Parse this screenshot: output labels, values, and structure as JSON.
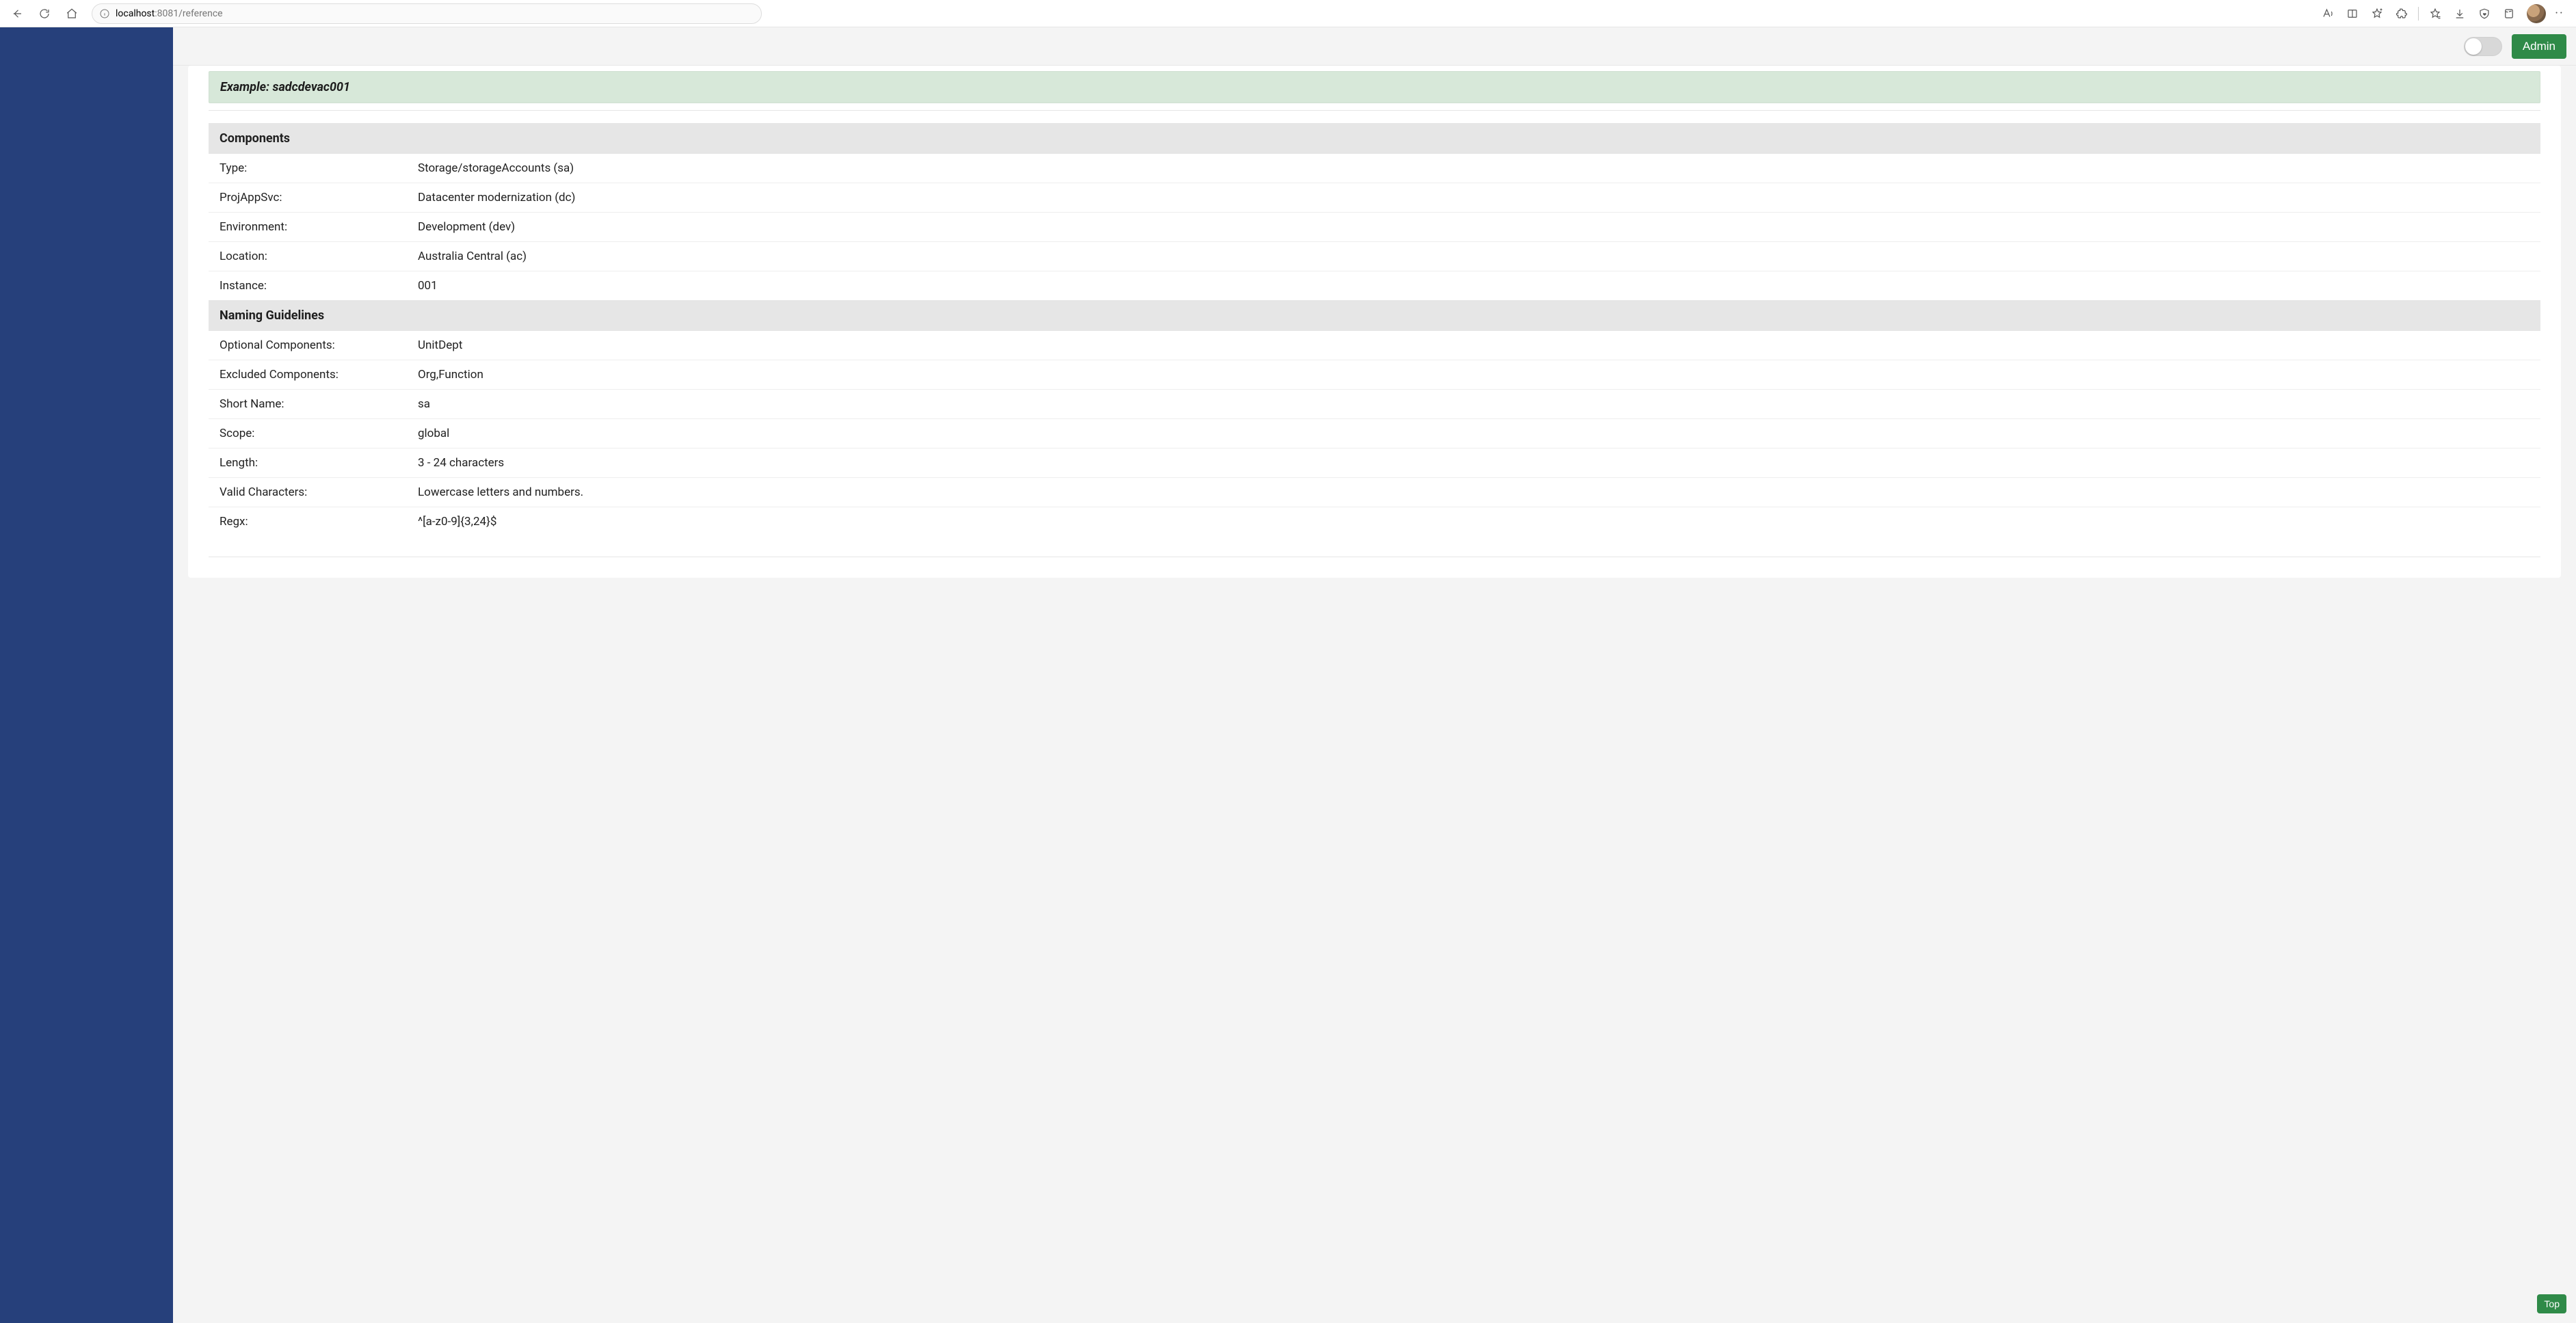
{
  "browser": {
    "url_host": "localhost",
    "url_port": ":8081",
    "url_path": "/reference"
  },
  "header": {
    "admin_label": "Admin"
  },
  "example": {
    "prefix": "Example: ",
    "value": "sadcdevac001"
  },
  "sections": {
    "components": {
      "title": "Components",
      "rows": [
        {
          "key": "Type:",
          "val": "Storage/storageAccounts (sa)"
        },
        {
          "key": "ProjAppSvc:",
          "val": "Datacenter modernization (dc)"
        },
        {
          "key": "Environment:",
          "val": "Development (dev)"
        },
        {
          "key": "Location:",
          "val": "Australia Central (ac)"
        },
        {
          "key": "Instance:",
          "val": "001"
        }
      ]
    },
    "guidelines": {
      "title": "Naming Guidelines",
      "rows": [
        {
          "key": "Optional Components:",
          "val": "UnitDept"
        },
        {
          "key": "Excluded Components:",
          "val": "Org,Function"
        },
        {
          "key": "Short Name:",
          "val": "sa"
        },
        {
          "key": "Scope:",
          "val": "global"
        },
        {
          "key": "Length:",
          "val": "3 - 24 characters"
        },
        {
          "key": "Valid Characters:",
          "val": "Lowercase letters and numbers."
        },
        {
          "key": "Regx:",
          "val": "^[a-z0-9]{3,24}$"
        }
      ]
    }
  },
  "footer": {
    "top_label": "Top"
  }
}
